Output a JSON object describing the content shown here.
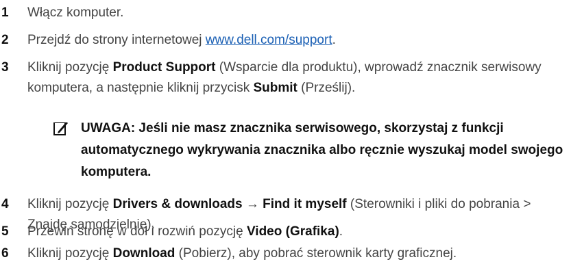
{
  "steps": [
    {
      "number": "1",
      "parts": [
        {
          "t": "text",
          "v": "Włącz komputer."
        }
      ]
    },
    {
      "number": "2",
      "parts": [
        {
          "t": "text",
          "v": "Przejdź do strony internetowej "
        },
        {
          "t": "link",
          "v": "www.dell.com/support"
        },
        {
          "t": "text",
          "v": "."
        }
      ]
    },
    {
      "number": "3",
      "parts": [
        {
          "t": "text",
          "v": "Kliknij pozycję "
        },
        {
          "t": "bold",
          "v": "Product Support"
        },
        {
          "t": "text",
          "v": " (Wsparcie dla produktu), wprowadź znacznik serwisowy komputera, a następnie kliknij przycisk "
        },
        {
          "t": "bold",
          "v": "Submit"
        },
        {
          "t": "text",
          "v": " (Prześlij)."
        }
      ]
    },
    {
      "number": "4",
      "parts": [
        {
          "t": "text",
          "v": "Kliknij pozycję "
        },
        {
          "t": "bold",
          "v": "Drivers & downloads"
        },
        {
          "t": "text",
          "v": " → "
        },
        {
          "t": "bold",
          "v": "Find it myself"
        },
        {
          "t": "text",
          "v": " (Sterowniki i pliki do pobrania > Znajdę samodzielnie)."
        }
      ]
    },
    {
      "number": "5",
      "parts": [
        {
          "t": "text",
          "v": "Przewiń stronę w dół i rozwiń pozycję "
        },
        {
          "t": "bold",
          "v": "Video (Grafika)"
        },
        {
          "t": "text",
          "v": "."
        }
      ]
    },
    {
      "number": "6",
      "parts": [
        {
          "t": "text",
          "v": "Kliknij pozycję "
        },
        {
          "t": "bold",
          "v": "Download"
        },
        {
          "t": "text",
          "v": " (Pobierz), aby pobrać sterownik karty graficznej."
        }
      ]
    }
  ],
  "note": {
    "icon": "pencil-note-icon",
    "text": "UWAGA: Jeśli nie masz znacznika serwisowego, skorzystaj z funkcji automatycznego wykrywania znacznika albo ręcznie wyszukaj model swojego komputera."
  }
}
